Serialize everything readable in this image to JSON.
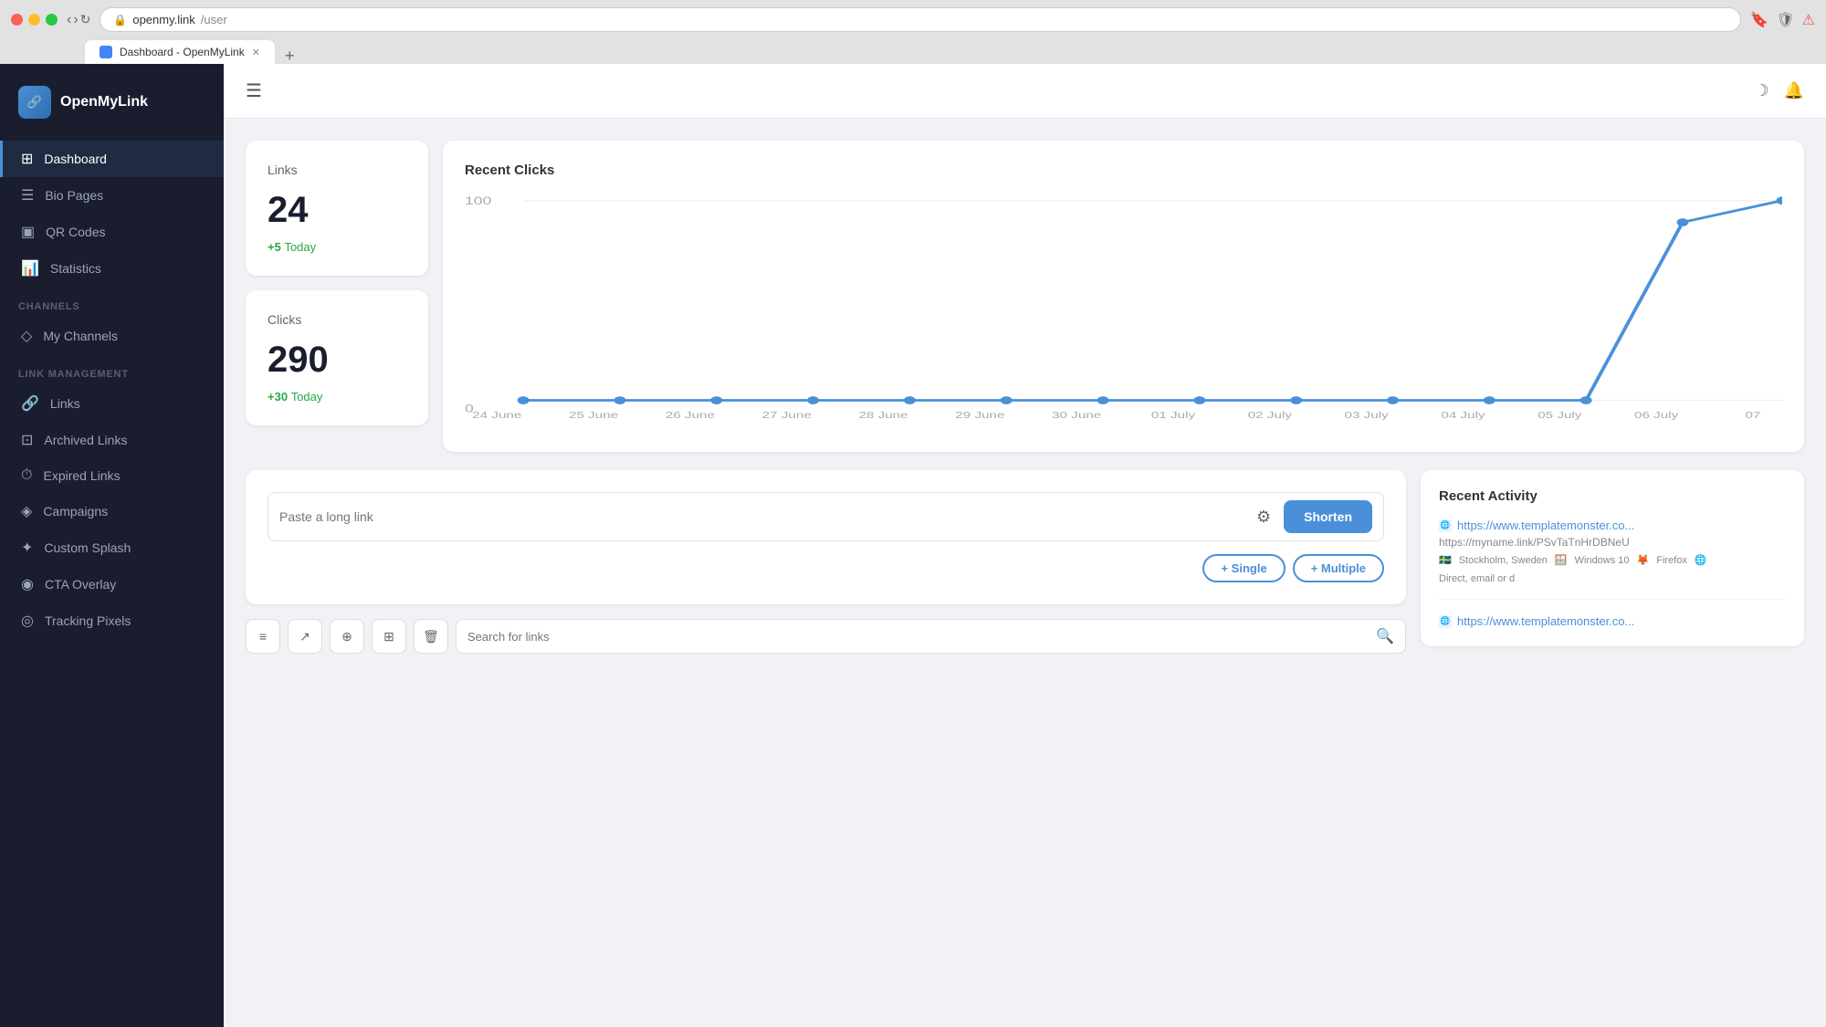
{
  "browser": {
    "tab_title": "Dashboard - OpenMyLink",
    "tab_url_domain": "openmy.link",
    "tab_url_path": "/user",
    "new_tab_label": "+"
  },
  "sidebar": {
    "logo_text": "OpenMyLink",
    "sections": [
      {
        "items": [
          {
            "label": "Dashboard",
            "icon": "⊞",
            "active": true
          },
          {
            "label": "Bio Pages",
            "icon": "☰"
          },
          {
            "label": "QR Codes",
            "icon": "◫"
          },
          {
            "label": "Statistics",
            "icon": "📊"
          }
        ]
      },
      {
        "title": "Channels",
        "items": [
          {
            "label": "My Channels",
            "icon": "◇"
          }
        ]
      },
      {
        "title": "Link Management",
        "items": [
          {
            "label": "Links",
            "icon": "🔗"
          },
          {
            "label": "Archived Links",
            "icon": "⊡"
          },
          {
            "label": "Expired Links",
            "icon": "⏱"
          },
          {
            "label": "Campaigns",
            "icon": "◈"
          },
          {
            "label": "Custom Splash",
            "icon": "✦"
          },
          {
            "label": "CTA Overlay",
            "icon": "◉"
          },
          {
            "label": "Tracking Pixels",
            "icon": "◎"
          }
        ]
      }
    ]
  },
  "topbar": {
    "menu_icon": "☰",
    "moon_icon": "☽",
    "bell_icon": "🔔"
  },
  "stats": {
    "links": {
      "label": "Links",
      "value": "24",
      "today_prefix": "+5",
      "today_suffix": "Today"
    },
    "clicks": {
      "label": "Clicks",
      "value": "290",
      "today_prefix": "+30",
      "today_suffix": "Today"
    }
  },
  "chart": {
    "title": "Recent Clicks",
    "y_max": "100",
    "y_zero": "0",
    "labels": [
      "24 June",
      "25 June",
      "26 June",
      "27 June",
      "28 June",
      "29 June",
      "30 June",
      "01 July",
      "02 July",
      "03 July",
      "04 July",
      "05 July",
      "06 July",
      "07"
    ],
    "data_points": [
      0,
      0,
      0,
      0,
      0,
      0,
      0,
      0,
      0,
      0,
      0,
      0,
      90,
      100
    ]
  },
  "shortener": {
    "placeholder": "Paste a long link",
    "shorten_label": "Shorten",
    "options": [
      {
        "label": "+ Single",
        "filled": false
      },
      {
        "label": "+ Multiple",
        "filled": false
      }
    ]
  },
  "activity": {
    "title": "Recent Activity",
    "items": [
      {
        "link": "https://www.templatemonster.co...",
        "short": "https://myname.link/PSvTaTnHrDBNeU",
        "location": "Stockholm, Sweden",
        "os": "Windows 10",
        "browser": "Firefox",
        "source": "Direct, email or d"
      },
      {
        "link": "https://www.templatemonster.co...",
        "short": "",
        "location": "",
        "os": "",
        "browser": "",
        "source": ""
      }
    ]
  },
  "toolbar": {
    "icons": [
      "≡",
      "↗",
      "⊕",
      "⊞",
      "🗑"
    ],
    "search_placeholder": "Search for links"
  }
}
